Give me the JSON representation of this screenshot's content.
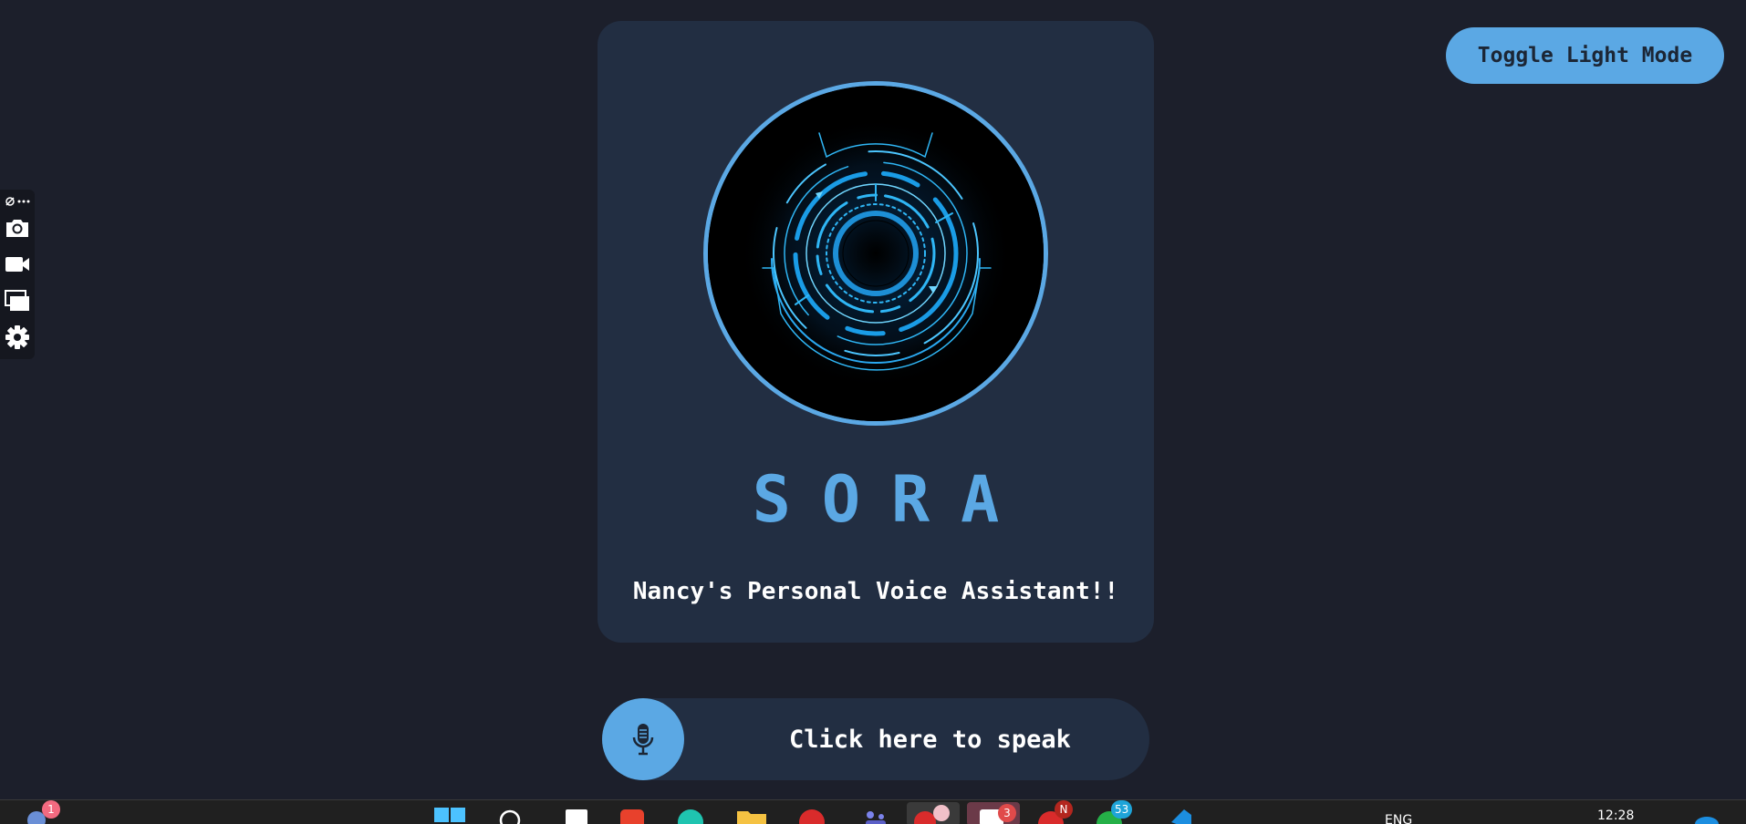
{
  "toggle_button": {
    "label": "Toggle Light Mode"
  },
  "assistant": {
    "name": "SORA",
    "subtitle": "Nancy's Personal Voice Assistant!!"
  },
  "speak": {
    "label": "Click here to speak"
  },
  "side_toolbar": {
    "items": [
      "screenshot-camera",
      "video-record",
      "windows",
      "settings"
    ]
  },
  "taskbar": {
    "widgets_badge": "1",
    "chrome_badge": "N",
    "whatsapp_badge": "53",
    "app_badge": "3",
    "language": "ENG",
    "time": "12:28"
  },
  "colors": {
    "background": "#1c1f2b",
    "card": "#222e42",
    "accent": "#5ba8e4"
  }
}
